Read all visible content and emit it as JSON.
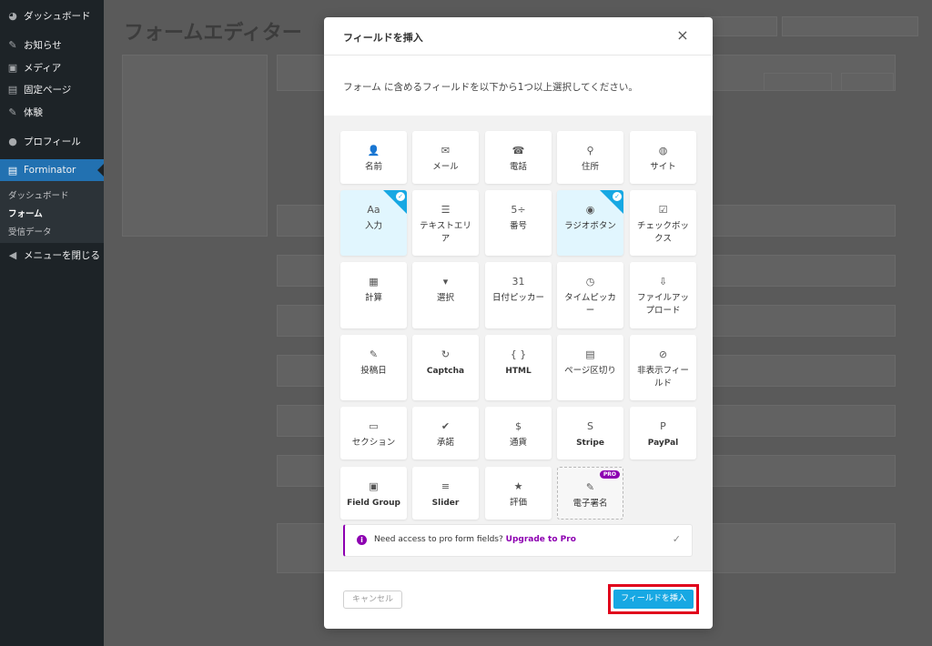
{
  "sidebar": {
    "items": [
      {
        "label": "ダッシュボード",
        "icon": "dashboard-icon"
      },
      {
        "label": "お知らせ",
        "icon": "pin-icon"
      },
      {
        "label": "メディア",
        "icon": "media-icon"
      },
      {
        "label": "固定ページ",
        "icon": "page-icon"
      },
      {
        "label": "体験",
        "icon": "pin-icon"
      },
      {
        "label": "プロフィール",
        "icon": "user-icon"
      },
      {
        "label": "Forminator",
        "icon": "forminator-icon"
      },
      {
        "label": "メニューを閉じる",
        "icon": "collapse-icon"
      }
    ],
    "submenu": [
      "ダッシュボード",
      "フォーム",
      "受信データ"
    ]
  },
  "background": {
    "page_title": "フォームエディター"
  },
  "modal": {
    "title": "フィールドを挿入",
    "close_symbol": "×",
    "intro": "フォーム に含めるフィールドを以下から1つ以上選択してください。",
    "fields": [
      {
        "label": "名前",
        "icon": "user-icon",
        "glyph": "👤"
      },
      {
        "label": "メール",
        "icon": "mail-icon",
        "glyph": "✉"
      },
      {
        "label": "電話",
        "icon": "phone-icon",
        "glyph": "☎"
      },
      {
        "label": "住所",
        "icon": "location-pin-icon",
        "glyph": "⚲"
      },
      {
        "label": "サイト",
        "icon": "globe-icon",
        "glyph": "◍"
      },
      {
        "label": "入力",
        "icon": "text-input-icon",
        "glyph": "Aa",
        "selected": true
      },
      {
        "label": "テキストエリア",
        "icon": "textarea-icon",
        "glyph": "☰"
      },
      {
        "label": "番号",
        "icon": "number-icon",
        "glyph": "5÷"
      },
      {
        "label": "ラジオボタン",
        "icon": "radio-icon",
        "glyph": "◉",
        "selected": true
      },
      {
        "label": "チェックボックス",
        "icon": "checkbox-icon",
        "glyph": "☑"
      },
      {
        "label": "計算",
        "icon": "calculator-icon",
        "glyph": "▦"
      },
      {
        "label": "選択",
        "icon": "select-icon",
        "glyph": "▾"
      },
      {
        "label": "日付ピッカー",
        "icon": "calendar-icon",
        "glyph": "31"
      },
      {
        "label": "タイムピッカー",
        "icon": "clock-icon",
        "glyph": "◷"
      },
      {
        "label": "ファイルアップロード",
        "icon": "upload-icon",
        "glyph": "⇩"
      },
      {
        "label": "投稿日",
        "icon": "pin-icon",
        "glyph": "✎"
      },
      {
        "label": "Captcha",
        "icon": "captcha-icon",
        "glyph": "↻"
      },
      {
        "label": "HTML",
        "icon": "code-icon",
        "glyph": "{ }"
      },
      {
        "label": "ページ区切り",
        "icon": "page-break-icon",
        "glyph": "▤"
      },
      {
        "label": "非表示フィールド",
        "icon": "eye-slash-icon",
        "glyph": "⊘"
      },
      {
        "label": "セクション",
        "icon": "section-icon",
        "glyph": "▭"
      },
      {
        "label": "承諾",
        "icon": "shield-check-icon",
        "glyph": "✔"
      },
      {
        "label": "通貨",
        "icon": "currency-icon",
        "glyph": "$"
      },
      {
        "label": "Stripe",
        "icon": "stripe-icon",
        "glyph": "S"
      },
      {
        "label": "PayPal",
        "icon": "paypal-icon",
        "glyph": "P"
      },
      {
        "label": "Field Group",
        "icon": "field-group-icon",
        "glyph": "▣"
      },
      {
        "label": "Slider",
        "icon": "slider-icon",
        "glyph": "≡"
      },
      {
        "label": "評価",
        "icon": "star-icon",
        "glyph": "★"
      },
      {
        "label": "電子署名",
        "icon": "pen-icon",
        "glyph": "✎",
        "pro": true
      }
    ],
    "pro_badge": "PRO",
    "upgrade": {
      "text": "Need access to pro form fields?",
      "link": "Upgrade to Pro",
      "info_symbol": "i",
      "dismiss_symbol": "✓"
    },
    "cancel_label": "キャンセル",
    "insert_label": "フィールドを挿入"
  },
  "colors": {
    "accent": "#17a8e3",
    "pro": "#8d00b1",
    "highlight": "#e0001b",
    "wp_blue": "#2271b1"
  }
}
